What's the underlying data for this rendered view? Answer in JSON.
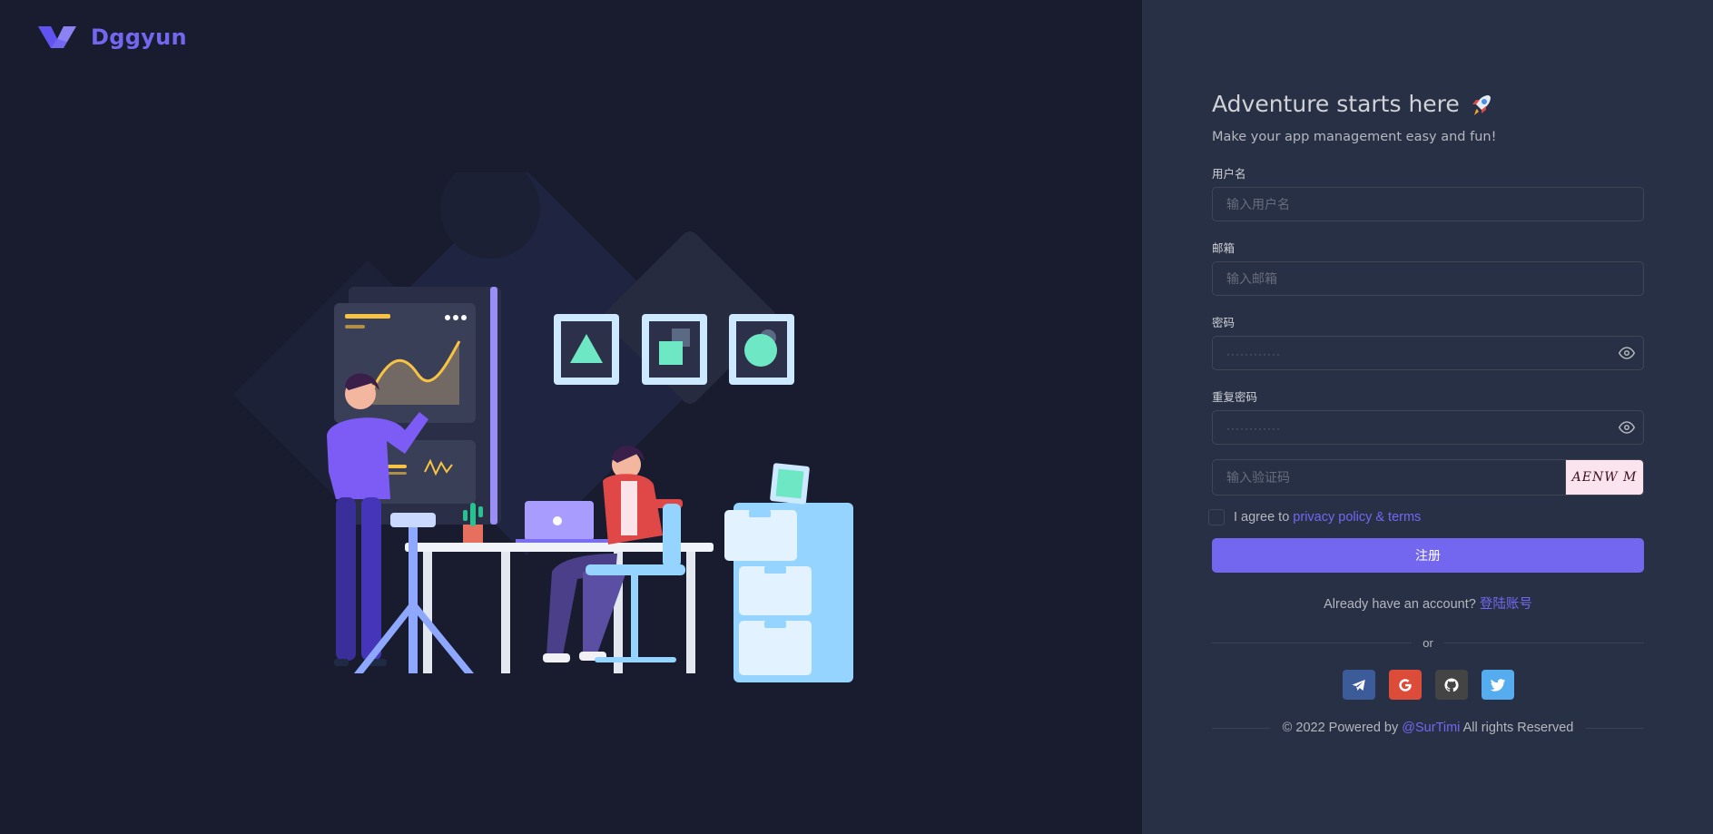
{
  "brand": {
    "name": "Dggyun",
    "logo_icon": "vuexy-v-logo-icon",
    "color": "#7367f0"
  },
  "illustration": {
    "icon": "office-workers-illustration-icon"
  },
  "form": {
    "title": "Adventure starts here",
    "title_icon": "rocket-icon",
    "subtitle": "Make your app management easy and fun!",
    "username": {
      "label": "用户名",
      "placeholder": "输入用户名",
      "value": ""
    },
    "email": {
      "label": "邮箱",
      "placeholder": "输入邮箱",
      "value": ""
    },
    "password": {
      "label": "密码",
      "placeholder": "············",
      "value": ""
    },
    "confirm_password": {
      "label": "重复密码",
      "placeholder": "············",
      "value": ""
    },
    "captcha": {
      "placeholder": "输入验证码",
      "value": "",
      "image_text": "AENW M"
    },
    "agree": {
      "prefix": "I agree to",
      "link": "privacy policy & terms",
      "checked": false
    },
    "submit_label": "注册",
    "signin": {
      "prefix": "Already have an account?",
      "link": "登陆账号"
    },
    "or_label": "or",
    "social": [
      {
        "name": "telegram",
        "icon": "telegram-icon",
        "color": "#3b5b99"
      },
      {
        "name": "google",
        "icon": "google-icon",
        "color": "#dd4b39"
      },
      {
        "name": "github",
        "icon": "github-icon",
        "color": "#444444"
      },
      {
        "name": "twitter",
        "icon": "twitter-icon",
        "color": "#55acee"
      }
    ]
  },
  "footer": {
    "prefix": "© 2022 Powered by",
    "link": "@SurTimi",
    "suffix": "All rights Reserved"
  },
  "colors": {
    "primary": "#7367f0",
    "left_bg": "#181c2e",
    "right_bg": "#283046"
  }
}
